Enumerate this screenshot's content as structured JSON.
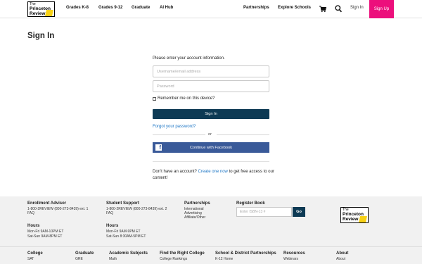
{
  "header": {
    "logo": {
      "line1": "The",
      "line2": "Princeton",
      "line3": "Review"
    },
    "nav": [
      "Grades K-8",
      "Grades 9-12",
      "Graduate",
      "AI Hub"
    ],
    "right_nav": [
      "Partnerships",
      "Explore Schools"
    ],
    "cart_icon": "cart-icon",
    "search_icon": "search-icon",
    "sign_in": "Sign In",
    "sign_up": "Sign Up",
    "accent_color": "#ec0f7c"
  },
  "main": {
    "title": "Sign In",
    "intro": "Please enter your account information.",
    "username_placeholder": "Username/email address",
    "password_placeholder": "Password",
    "remember_label": "Remember me on this device?",
    "signin_button": "Sign In",
    "forgot_link": "Forgot your password?",
    "or_text": "or",
    "facebook_button": "Continue with Facebook",
    "no_account_prefix": "Don't have an account?",
    "create_link": "Create one now",
    "no_account_suffix": "to get free access to our content!",
    "primary_color": "#0d3a54",
    "facebook_color": "#3a5a99"
  },
  "footer": {
    "enrollment": {
      "heading": "Enrollment Advisor",
      "line1": "1-800-2REVIEW (800-273-8439) ext. 1",
      "line2": "FAQ",
      "hours_heading": "Hours",
      "hours1": "Mon-Fri 9AM-10PM ET",
      "hours2": "Sat-Sun 9AM-8PM ET"
    },
    "support": {
      "heading": "Student Support",
      "line1": "1-800-2REVIEW (800-273-8439) ext. 2",
      "line2": "FAQ",
      "hours_heading": "Hours",
      "hours1": "Mon-Fri 9AM-9PM ET",
      "hours2": "Sat-Sun 8:30AM-5PM ET"
    },
    "partnerships": {
      "heading": "Partnerships",
      "items": [
        "International",
        "Advertising",
        "Affiliate/Other"
      ]
    },
    "register": {
      "heading": "Register Book",
      "placeholder": "Enter ISBN-13 #",
      "go": "Go"
    },
    "columns": [
      {
        "heading": "College",
        "first": "SAT"
      },
      {
        "heading": "Graduate",
        "first": "GRE"
      },
      {
        "heading": "Academic Subjects",
        "first": "Math"
      },
      {
        "heading": "Find the Right College",
        "first": "College Rankings"
      },
      {
        "heading": "School & District Partnerships",
        "first": "K-12 Home"
      },
      {
        "heading": "Resources",
        "first": "Webinars"
      },
      {
        "heading": "About",
        "first": "About"
      }
    ]
  }
}
